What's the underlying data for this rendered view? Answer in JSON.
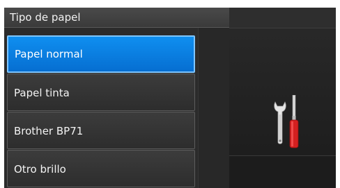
{
  "header": {
    "title": "Tipo de papel"
  },
  "list": {
    "items": [
      {
        "label": "Papel normal",
        "selected": true
      },
      {
        "label": "Papel tinta",
        "selected": false
      },
      {
        "label": "Brother BP71",
        "selected": false
      },
      {
        "label": "Otro brillo",
        "selected": false
      }
    ]
  },
  "settings_icon": "wrench-screwdriver-icon",
  "colors": {
    "selected": "#0a7fe0",
    "background": "#1f1f1f",
    "screwdriver_handle": "#d42020"
  }
}
